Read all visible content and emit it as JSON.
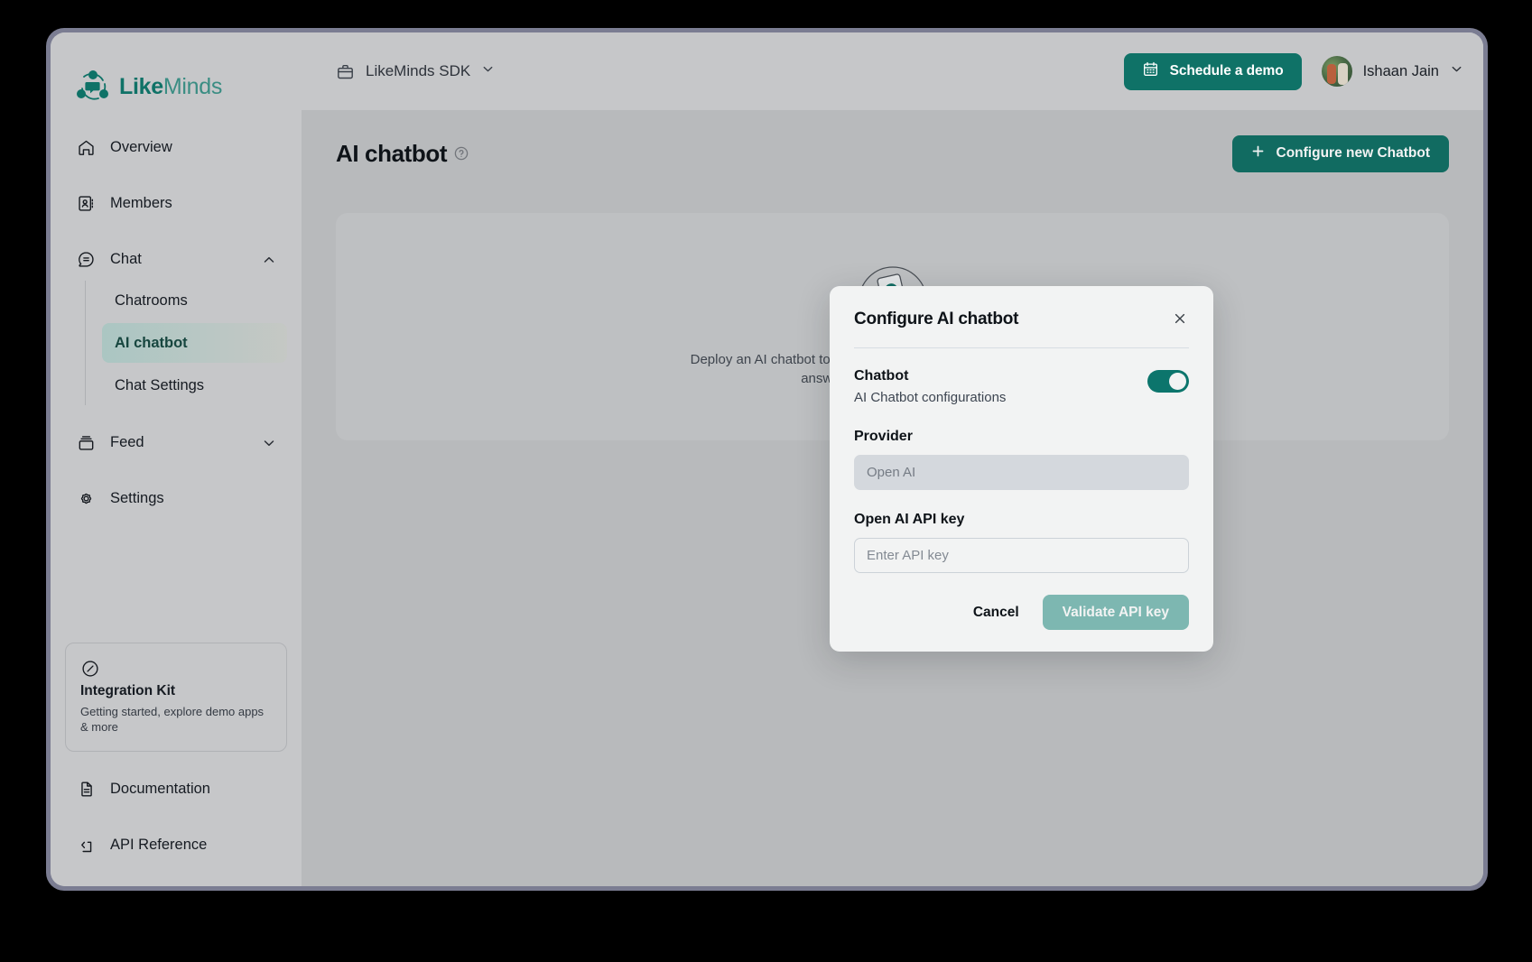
{
  "brand": {
    "name_bold": "Like",
    "name_light": "Minds",
    "logo_icon": "likeminds-logo-icon"
  },
  "sidebar": {
    "items": [
      {
        "label": "Overview",
        "icon": "home-icon",
        "expandable": false
      },
      {
        "label": "Members",
        "icon": "contact-book-icon",
        "expandable": false
      },
      {
        "label": "Chat",
        "icon": "chat-bubble-icon",
        "expandable": true,
        "expanded": true,
        "chevron": "chevron-up-icon"
      },
      {
        "label": "Feed",
        "icon": "feed-stack-icon",
        "expandable": true,
        "expanded": false,
        "chevron": "chevron-down-icon"
      },
      {
        "label": "Settings",
        "icon": "gear-icon",
        "expandable": false
      }
    ],
    "chat_children": [
      {
        "label": "Chatrooms",
        "active": false
      },
      {
        "label": "AI chatbot",
        "active": true
      },
      {
        "label": "Chat Settings",
        "active": false
      }
    ],
    "integration_kit": {
      "icon": "compass-icon",
      "title": "Integration Kit",
      "subtitle": "Getting started, explore demo apps & more"
    },
    "footer_items": [
      {
        "label": "Documentation",
        "icon": "document-icon"
      },
      {
        "label": "API Reference",
        "icon": "code-brackets-icon"
      }
    ]
  },
  "topbar": {
    "sdk_selector": {
      "icon": "briefcase-icon",
      "label": "LikeMinds SDK",
      "chevron": "chevron-down-icon"
    },
    "schedule_demo": {
      "label": "Schedule a demo",
      "icon": "calendar-icon"
    },
    "user": {
      "name": "Ishaan Jain",
      "avatar": "user-avatar",
      "chevron": "chevron-down-icon"
    }
  },
  "page": {
    "title": "AI chatbot",
    "title_help_icon": "help-circle-icon",
    "configure_button": {
      "label": "Configure new Chatbot",
      "icon": "plus-icon"
    },
    "empty_state": {
      "illustration": "hand-holding-phone-icon",
      "text": "Deploy an AI chatbot to give members real-time support and instant answers right inside your chat."
    }
  },
  "modal": {
    "title": "Configure AI chatbot",
    "close_icon": "close-icon",
    "chatbot_row": {
      "label": "Chatbot",
      "description": "AI Chatbot configurations",
      "toggle_on": true
    },
    "provider": {
      "label": "Provider",
      "value": "Open AI",
      "disabled": true
    },
    "api_key": {
      "label": "Open AI API key",
      "placeholder": "Enter API key",
      "value": ""
    },
    "actions": {
      "cancel_label": "Cancel",
      "validate_label": "Validate API key",
      "validate_disabled": true
    }
  },
  "colors": {
    "brand_teal": "#0f7267",
    "toggle_on": "#0b7a70",
    "validate_disabled": "#83c0b9",
    "sidebar_bg": "#c6c7c9",
    "window_border": "#7b7d92"
  }
}
